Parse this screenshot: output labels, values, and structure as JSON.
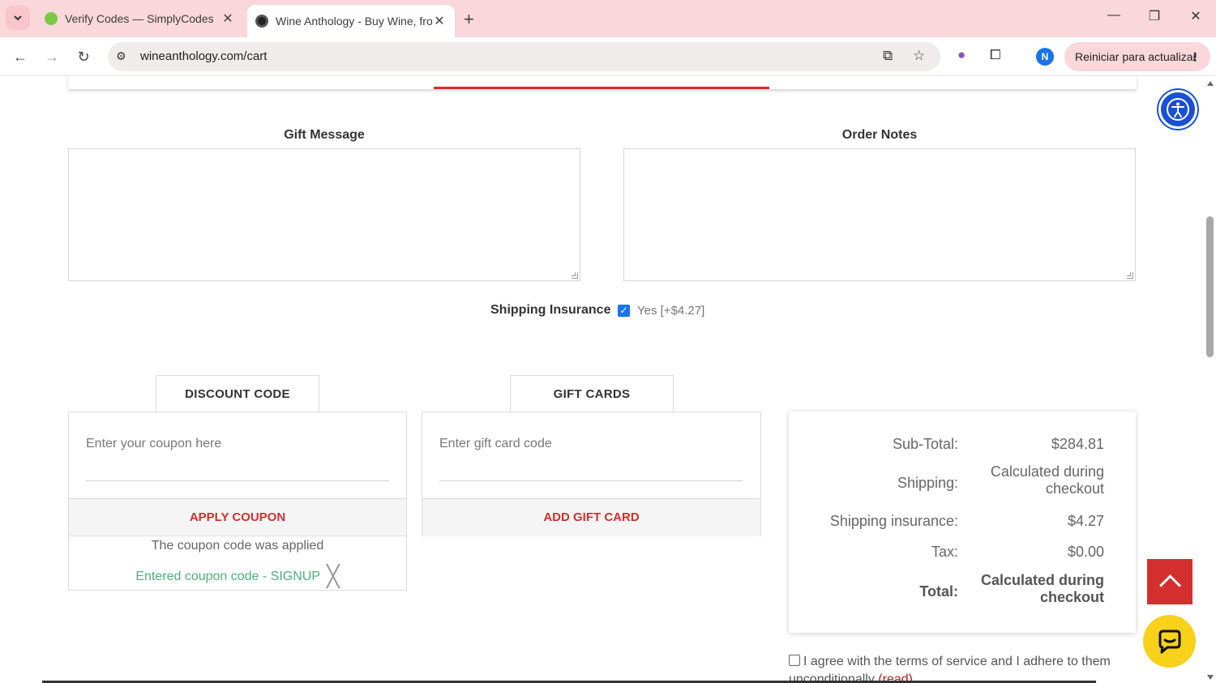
{
  "browser": {
    "tabs": [
      {
        "label": "Verify Codes — SimplyCodes",
        "favicon": "simplycodes-icon"
      },
      {
        "label": "Wine Anthology - Buy Wine, fro",
        "favicon": "wine-anthology-icon"
      }
    ],
    "url": "wineanthology.com/cart",
    "profile_initial": "N",
    "restart_label": "Reiniciar para actualizar"
  },
  "cart": {
    "gift_message_label": "Gift Message",
    "order_notes_label": "Order Notes",
    "shipping_insurance": {
      "label": "Shipping Insurance",
      "checked": true,
      "option_text": "Yes [+$4.27]"
    },
    "discount": {
      "tab_label": "DISCOUNT CODE",
      "placeholder": "Enter your coupon here",
      "button_label": "APPLY COUPON",
      "applied_message": "The coupon code was applied",
      "entered_code_text": "Entered coupon code - SIGNUP"
    },
    "gift_cards": {
      "tab_label": "GIFT CARDS",
      "placeholder": "Enter gift card code",
      "button_label": "ADD GIFT CARD"
    },
    "summary": {
      "subtotal_label": "Sub-Total:",
      "subtotal_value": "$284.81",
      "shipping_label": "Shipping:",
      "shipping_value_line1": "Calculated during",
      "shipping_value_line2": "checkout",
      "insurance_label": "Shipping insurance:",
      "insurance_value": "$4.27",
      "tax_label": "Tax:",
      "tax_value": "$0.00",
      "total_label": "Total:",
      "total_value_line1": "Calculated during",
      "total_value_line2": "checkout"
    },
    "terms": {
      "text": "I agree with the terms of service and I adhere to them unconditionally",
      "read_link": "(read)"
    }
  },
  "colors": {
    "accent_red": "#d32f2f",
    "coupon_green": "#4caf7d",
    "chat_yellow": "#f7d11a",
    "accessibility_blue": "#1a4fd6",
    "tabbar_pink": "#f9d7da"
  }
}
